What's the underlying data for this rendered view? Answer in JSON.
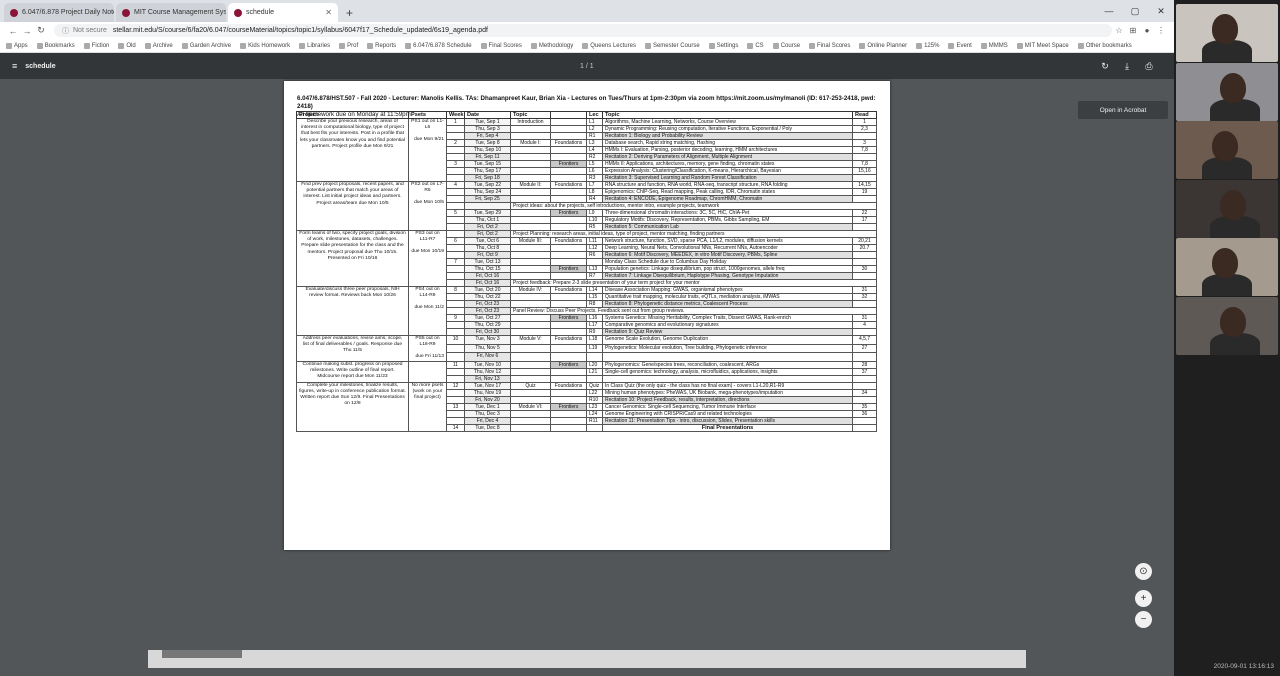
{
  "browser": {
    "tabs": [
      {
        "label": "6.047/6.878 Project Daily Notes"
      },
      {
        "label": "MIT Course Management System"
      },
      {
        "label": "schedule",
        "active": true
      }
    ],
    "new_tab": "+",
    "window_controls": [
      "—",
      "▢",
      "✕"
    ],
    "nav": {
      "back": "←",
      "forward": "→",
      "reload": "↻"
    },
    "url": {
      "security": "Not secure",
      "address": "stellar.mit.edu/S/course/6/fa20/6.047/courseMaterial/topics/topic1/syllabus/6047f17_Schedule_updated/6s19_agenda.pdf"
    },
    "bookmarks": [
      "Apps",
      "Bookmarks",
      "Fiction",
      "Old",
      "Archive",
      "Garden Archive",
      "Kids Homework",
      "Libraries",
      "Prof",
      "Reports",
      "6.047/6.878 Schedule",
      "Final Scores",
      "Methodology",
      "Queens Lectures",
      "Semester Course",
      "Settings",
      "CS",
      "Course",
      "Final Scores",
      "Online Planner",
      "125%",
      "Event",
      "MMMS",
      "MIT Meet Space",
      "Other bookmarks"
    ]
  },
  "pdf_viewer": {
    "filename": "schedule",
    "page_indicator": "1 / 1",
    "open_in_acrobat": "Open in Acrobat",
    "icons": [
      "rotate-icon",
      "download-icon",
      "print-icon"
    ]
  },
  "document": {
    "title_line": "6.047/6.878/HST.507 - Fall 2020 - Lecturer: Manolis Kellis. TAs: Dhamanpreet Kaur, Brian Xia - Lectures on Tues/Thurs at 1pm-2:30pm via zoom https://mit.zoom.us/my/manoli (ID: 617-253-2418, pwd: 2418)",
    "subtitle_line": "All homework due on Monday at 11:59pm",
    "headers": [
      "Project",
      "Psets",
      "Week",
      "Date",
      "Topic",
      "",
      "Lec",
      "Topic",
      "Read"
    ],
    "weeks": [
      {
        "project": "Describe your previous research, areas of interest in computational biology, type of project that best fits your interests. Post in a profile that lets your classmates know you and find potential partners. Project profile due Mon 9/21",
        "pset": "PS1 out on L1-L6",
        "pset_due": "due Mon 9/21",
        "rows": [
          {
            "week": "1",
            "date": "Tue, Sep 1",
            "module": "Introduction",
            "lec": "L1",
            "topic": "Algorithms, Machine Learning, Networks, Course Overview",
            "read": "1"
          },
          {
            "week": "",
            "date": "Thu, Sep 3",
            "module": "",
            "lec": "L2",
            "topic": "Dynamic Programming: Reusing computation, Iterative Functions, Exponential / Poly",
            "read": "2,3"
          },
          {
            "week": "",
            "date": "Fri, Sep 4",
            "module": "",
            "lec": "R1",
            "topic": "Recitation 1: Biology and Probability Review",
            "read": ""
          },
          {
            "week": "2",
            "date": "Tue, Sep 8",
            "module": "Module I:",
            "sub": "Foundations",
            "lec": "L3",
            "topic": "Database search, Rapid string matching, Hashing",
            "read": "3"
          },
          {
            "week": "",
            "date": "Thu, Sep 10",
            "module": "",
            "lec": "L4",
            "topic": "HMMs I: Evaluation, Parsing, posterior decoding, learning, HMM architectures",
            "read": "7,8"
          },
          {
            "week": "",
            "date": "Fri, Sep 11",
            "module": "",
            "lec": "R2",
            "topic": "Recitation 2: Deriving Parameters of Alignment, Multiple Alignment",
            "read": ""
          },
          {
            "week": "3",
            "date": "Tue, Sep 15",
            "module": "",
            "sub": "Frontiers",
            "lec": "L5",
            "topic": "HMMs II: Applications, architectures, memory, gene finding, chromatin states",
            "read": "7,8"
          },
          {
            "week": "",
            "date": "Thu, Sep 17",
            "module": "",
            "lec": "L6",
            "topic": "Expression Analysis: Clustering/Classification, K-means, Hierarchical, Bayesian",
            "read": "15,16"
          },
          {
            "week": "",
            "date": "Fri, Sep 18",
            "module": "",
            "lec": "R3",
            "topic": "Recitation 3: Supervised Learning and Random Forest Classification",
            "read": ""
          }
        ]
      },
      {
        "project": "Find prev project proposals, recent papers, and potential partners that match your areas of interest. List initial project ideas and partners. Project areas/team due Mon 10/5",
        "pset": "PS2 out on L7-R5",
        "pset_due": "due Mon 10/5",
        "rows": [
          {
            "week": "4",
            "date": "Tue, Sep 22",
            "module": "Module II:",
            "sub": "Foundations",
            "lec": "L7",
            "topic": "RNA structure and function, RNA world, RNA-seq, transcript structure, RNA folding",
            "read": "14,15"
          },
          {
            "week": "",
            "date": "Thu, Sep 24",
            "module": "",
            "lec": "L8",
            "topic": "Epigenomics: ChIP-Seq, Read mapping, Peak calling, IDR, Chromatin states",
            "read": "19"
          },
          {
            "week": "",
            "date": "Fri, Sep 25",
            "module": "",
            "lec": "R4",
            "topic": "Recitation 4: ENCODE, Epigenome Roadmap, ChromHMM, Chromatin",
            "read": ""
          },
          {
            "week": "",
            "date": "",
            "module": "full",
            "lec": "",
            "topic": "Project ideas: about the projects, self introductions, mentor intro, example projects, teamwork",
            "read": ""
          },
          {
            "week": "5",
            "date": "Tue, Sep 29",
            "module": "",
            "sub": "Frontiers",
            "lec": "L9",
            "topic": "Three-dimensional chromatin interactions: 3C, 5C, HiC, ChIA-Pet",
            "read": "22"
          },
          {
            "week": "",
            "date": "Thu, Oct 1",
            "module": "",
            "lec": "L10",
            "topic": "Regulatory Motifs: Discovery, Representation, PBMs, Gibbs Sampling, EM",
            "read": "17"
          },
          {
            "week": "",
            "date": "Fri, Oct 2",
            "module": "",
            "lec": "R5",
            "topic": "Recitation 5: Communication Lab",
            "read": ""
          }
        ]
      },
      {
        "project": "Form teams of two, specify project goals, division of work, milestones, datasets, challenges. Prepare slide presentation for the class and the mentors. Project proposal due Thu 10/15. Presented on Fri 10/16",
        "pset": "PS3 out on L11-R7",
        "pset_due": "due Mon 10/19",
        "rows": [
          {
            "week": "",
            "date": "Fri, Oct 2",
            "module": "full",
            "lec": "",
            "topic": "Project Planning: research areas, initial ideas, type of project, mentor matching, finding partners",
            "read": ""
          },
          {
            "week": "6",
            "date": "Tue, Oct 6",
            "module": "Module III:",
            "sub": "Foundations",
            "lec": "L11",
            "topic": "Network structure, function, SVD, sparse PCA, L1/L2, modules, diffusion kernels",
            "read": "20,21"
          },
          {
            "week": "",
            "date": "Thu, Oct 8",
            "module": "",
            "lec": "L12",
            "topic": "Deep Learning, Neural Nets, Convolutional NNs, Recurrent NNs, Autoencoder",
            "read": "20.7"
          },
          {
            "week": "",
            "date": "Fri, Oct 9",
            "module": "",
            "lec": "R6",
            "topic": "Recitation 6: Motif Discovery, MEEDEX, in vitro Motif Discovery, PBMs, Spline",
            "read": ""
          },
          {
            "week": "7",
            "date": "Tue, Oct 13",
            "module": "",
            "lec": "",
            "topic": "Monday Class Schedule due to Columbus Day Holiday",
            "read": ""
          },
          {
            "week": "",
            "date": "Thu, Oct 15",
            "module": "",
            "sub": "Frontiers",
            "lec": "L13",
            "topic": "Population genetics: Linkage disequilibrium, pop struct, 1000genomes, allele freq",
            "read": "30"
          },
          {
            "week": "",
            "date": "Fri, Oct 16",
            "module": "",
            "lec": "R7",
            "topic": "Recitation 7: Linkage Disequilibrium, Haplotype Phasing, Genotype Imputation",
            "read": ""
          },
          {
            "week": "",
            "date": "Fri, Oct 16",
            "module": "full",
            "lec": "",
            "topic": "Project feedback: Prepare 2-3 slide presentation of your term project for your mentor",
            "read": ""
          }
        ]
      },
      {
        "project": "Evaluate/discuss three peer proposals, NIH review format. Reviews back Mon 10/26",
        "pset": "PS4 out on L14-R9",
        "pset_due": "due Mon 11/2",
        "rows": [
          {
            "week": "8",
            "date": "Tue, Oct 20",
            "module": "Module IV:",
            "sub": "Foundations",
            "lec": "L14",
            "topic": "Disease Association Mapping: GWAS, organismal phenotypes",
            "read": "31"
          },
          {
            "week": "",
            "date": "Thu, Oct 22",
            "module": "",
            "lec": "L15",
            "topic": "Quantitative trait mapping, molecular traits, eQTLs, mediation analysis, iMWAS",
            "read": "32"
          },
          {
            "week": "",
            "date": "Fri, Oct 23",
            "module": "",
            "lec": "R8",
            "topic": "Recitation 8: Phylogenetic distance metrics, Coalescent Process",
            "read": ""
          },
          {
            "week": "",
            "date": "Fri, Oct 23",
            "module": "full",
            "lec": "",
            "topic": "Panel Review: Discuss Peer Projects. Feedback sent out from group reviews.",
            "read": ""
          },
          {
            "week": "9",
            "date": "Tue, Oct 27",
            "module": "",
            "sub": "Frontiers",
            "lec": "L16",
            "topic": "Systems Genetics: Missing Heritability, Complex Traits, Dissect GWAS, Rank-enrich",
            "read": "31"
          },
          {
            "week": "",
            "date": "Thu, Oct 29",
            "module": "",
            "lec": "L17",
            "topic": "Comparative genomics and evolutionary signatures",
            "read": "4"
          },
          {
            "week": "",
            "date": "Fri, Oct 30",
            "module": "",
            "lec": "R9",
            "topic": "Recitation 9: Quiz Review",
            "read": ""
          }
        ]
      },
      {
        "project": "Address peer evaluations, revise aims, scope, list of final deliverables / goals. Response due Thu 11/5",
        "pset": "PS5 out on L18-R9",
        "pset_due": "due Fri 11/13",
        "rows": [
          {
            "week": "10",
            "date": "Tue, Nov 3",
            "module": "Module V:",
            "sub": "Foundations",
            "lec": "L18",
            "topic": "Genome Scale Evolution, Genome Duplication",
            "read": "4,5,7"
          },
          {
            "week": "",
            "date": "Thu, Nov 5",
            "module": "",
            "lec": "L19",
            "topic": "Phylogenetics: Molecular evolution, Tree building, Phylogenetic inference",
            "read": "27"
          },
          {
            "week": "",
            "date": "Fri, Nov 6",
            "module": "",
            "lec": "",
            "topic": "",
            "read": ""
          }
        ]
      },
      {
        "project": "Continue making subst. progress on proposed milestones. Write outline of final report. Midcourse report due Mon 11/23",
        "pset": "",
        "pset_due": "",
        "rows": [
          {
            "week": "11",
            "date": "Tue, Nov 10",
            "module": "",
            "sub": "Frontiers",
            "lec": "L20",
            "topic": "Phylogenomics: Gene/species trees, reconciliation, coalescent, ARGs",
            "read": "28"
          },
          {
            "week": "",
            "date": "Thu, Nov 12",
            "module": "",
            "lec": "L21",
            "topic": "Single-cell genomics: technology, analysis, microfluidics, applications, insights",
            "read": "37"
          },
          {
            "week": "",
            "date": "Fri, Nov 13",
            "module": "",
            "lec": "",
            "topic": "",
            "read": ""
          }
        ]
      },
      {
        "project": "Complete your milestones, finalize results, figures, write-up in conference publication format. Written report due Sun 12/9. Final Presentations on 12/8",
        "pset": "No more psets (work on your final project)",
        "pset_due": "",
        "rows": [
          {
            "week": "12",
            "date": "Tue, Nov 17",
            "module": "Quiz",
            "sub": "Foundations",
            "lec": "Quiz",
            "topic": "In Class Quiz (the only quiz - the class has no final exam) - covers L1-L20,R1-R9",
            "read": ""
          },
          {
            "week": "",
            "date": "Thu, Nov 19",
            "module": "",
            "lec": "L22",
            "topic": "Mining human phenotypes: PheWAS, UK Biobank, mega-phenotypes/imputation",
            "read": "34"
          },
          {
            "week": "",
            "date": "Fri, Nov 20",
            "module": "",
            "lec": "R10",
            "topic": "Recitation 10: Project Feedback, results, interpretation, directions",
            "read": ""
          },
          {
            "week": "13",
            "date": "Tue, Dec 1",
            "module": "Module VI:",
            "sub": "Frontiers",
            "lec": "L23",
            "topic": "Cancer Genomics: Single-cell Sequencing, Tumor Immune Interface",
            "read": "35"
          },
          {
            "week": "",
            "date": "Thu, Dec 3",
            "module": "",
            "lec": "L24",
            "topic": "Genome Engineering with CRISPR/Cas9 and related technologies",
            "read": "36"
          },
          {
            "week": "",
            "date": "Fri, Dec 4",
            "module": "",
            "lec": "R11",
            "topic": "Recitation 11: Presentation Tips - intro, discussion, Slides, Presentation skills",
            "read": ""
          },
          {
            "week": "14",
            "date": "Tue, Dec 8",
            "module": "",
            "lec": "",
            "topic": "Final Presentations",
            "read": "",
            "final": true
          }
        ]
      }
    ]
  },
  "video_call": {
    "participants": 6,
    "clock": "2020-09-01 13:16:13"
  }
}
